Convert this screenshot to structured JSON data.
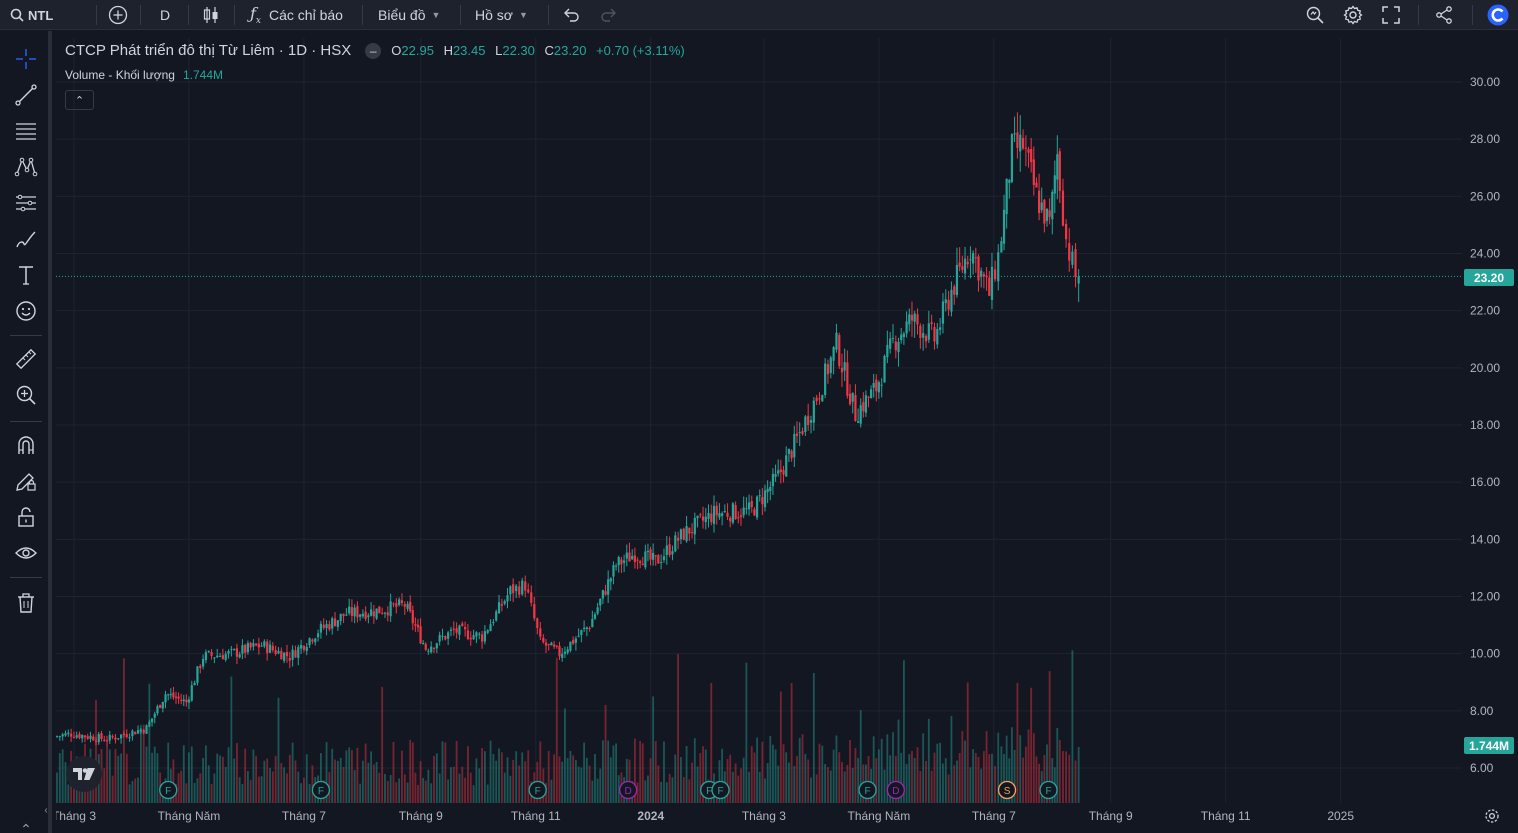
{
  "toolbar": {
    "symbol": "NTL",
    "interval": "D",
    "indicators_label": "Các chỉ báo",
    "chart_label": "Biểu đồ",
    "profile_label": "Hồ sơ"
  },
  "legend": {
    "title": "CTCP Phát triển đô thị Từ Liêm · 1D · HSX",
    "o_label": "O",
    "o_value": "22.95",
    "h_label": "H",
    "h_value": "23.45",
    "l_label": "L",
    "l_value": "22.30",
    "c_label": "C",
    "c_value": "23.20",
    "change": "+0.70 (+3.11%)",
    "volume_label": "Volume - Khối lượng",
    "volume_value": "1.744M"
  },
  "price_tags": {
    "last_price": "23.20",
    "last_volume": "1.744M"
  },
  "colors": {
    "up": "#26a69a",
    "down": "#f23645",
    "background": "#131722",
    "accent": "#2962ff"
  },
  "chart_data": {
    "type": "candlestick",
    "y_ticks": [
      "30.00",
      "28.00",
      "26.00",
      "24.00",
      "22.00",
      "20.00",
      "18.00",
      "16.00",
      "14.00",
      "12.00",
      "10.00",
      "8.00",
      "6.00"
    ],
    "ylim": [
      5.0,
      31.5
    ],
    "x_ticks": [
      "Tháng 3",
      "Tháng Năm",
      "Tháng 7",
      "Tháng 9",
      "Tháng 11",
      "2024",
      "Tháng 3",
      "Tháng Năm",
      "Tháng 7",
      "Tháng 9",
      "Tháng 11",
      "2025"
    ],
    "grid": true,
    "close_anchors": [
      [
        "2023-02-20",
        7.1
      ],
      [
        "2023-03-01",
        7.2
      ],
      [
        "2023-03-20",
        7.0
      ],
      [
        "2023-04-10",
        7.4
      ],
      [
        "2023-04-20",
        8.6
      ],
      [
        "2023-05-01",
        8.3
      ],
      [
        "2023-05-10",
        9.9
      ],
      [
        "2023-05-25",
        10.0
      ],
      [
        "2023-06-10",
        10.3
      ],
      [
        "2023-06-25",
        9.9
      ],
      [
        "2023-07-10",
        10.8
      ],
      [
        "2023-07-25",
        11.4
      ],
      [
        "2023-08-10",
        11.5
      ],
      [
        "2023-08-25",
        11.7
      ],
      [
        "2023-09-05",
        10.2
      ],
      [
        "2023-09-20",
        10.8
      ],
      [
        "2023-10-05",
        10.6
      ],
      [
        "2023-10-20",
        12.2
      ],
      [
        "2023-10-28",
        12.4
      ],
      [
        "2023-11-05",
        10.4
      ],
      [
        "2023-11-15",
        10.0
      ],
      [
        "2023-12-01",
        11.0
      ],
      [
        "2023-12-15",
        13.1
      ],
      [
        "2023-12-25",
        13.5
      ],
      [
        "2024-01-05",
        13.2
      ],
      [
        "2024-01-20",
        14.2
      ],
      [
        "2024-02-05",
        14.9
      ],
      [
        "2024-02-25",
        15.0
      ],
      [
        "2024-03-10",
        16.2
      ],
      [
        "2024-03-20",
        17.5
      ],
      [
        "2024-04-01",
        19.2
      ],
      [
        "2024-04-10",
        20.8
      ],
      [
        "2024-04-20",
        18.4
      ],
      [
        "2024-05-01",
        19.3
      ],
      [
        "2024-05-10",
        20.9
      ],
      [
        "2024-05-20",
        21.7
      ],
      [
        "2024-06-01",
        21.0
      ],
      [
        "2024-06-10",
        22.7
      ],
      [
        "2024-06-20",
        24.2
      ],
      [
        "2024-06-30",
        22.6
      ],
      [
        "2024-07-05",
        23.9
      ],
      [
        "2024-07-12",
        27.6
      ],
      [
        "2024-07-18",
        27.8
      ],
      [
        "2024-07-25",
        26.0
      ],
      [
        "2024-08-01",
        25.0
      ],
      [
        "2024-08-05",
        27.5
      ],
      [
        "2024-08-10",
        24.5
      ],
      [
        "2024-08-15",
        23.2
      ]
    ]
  }
}
